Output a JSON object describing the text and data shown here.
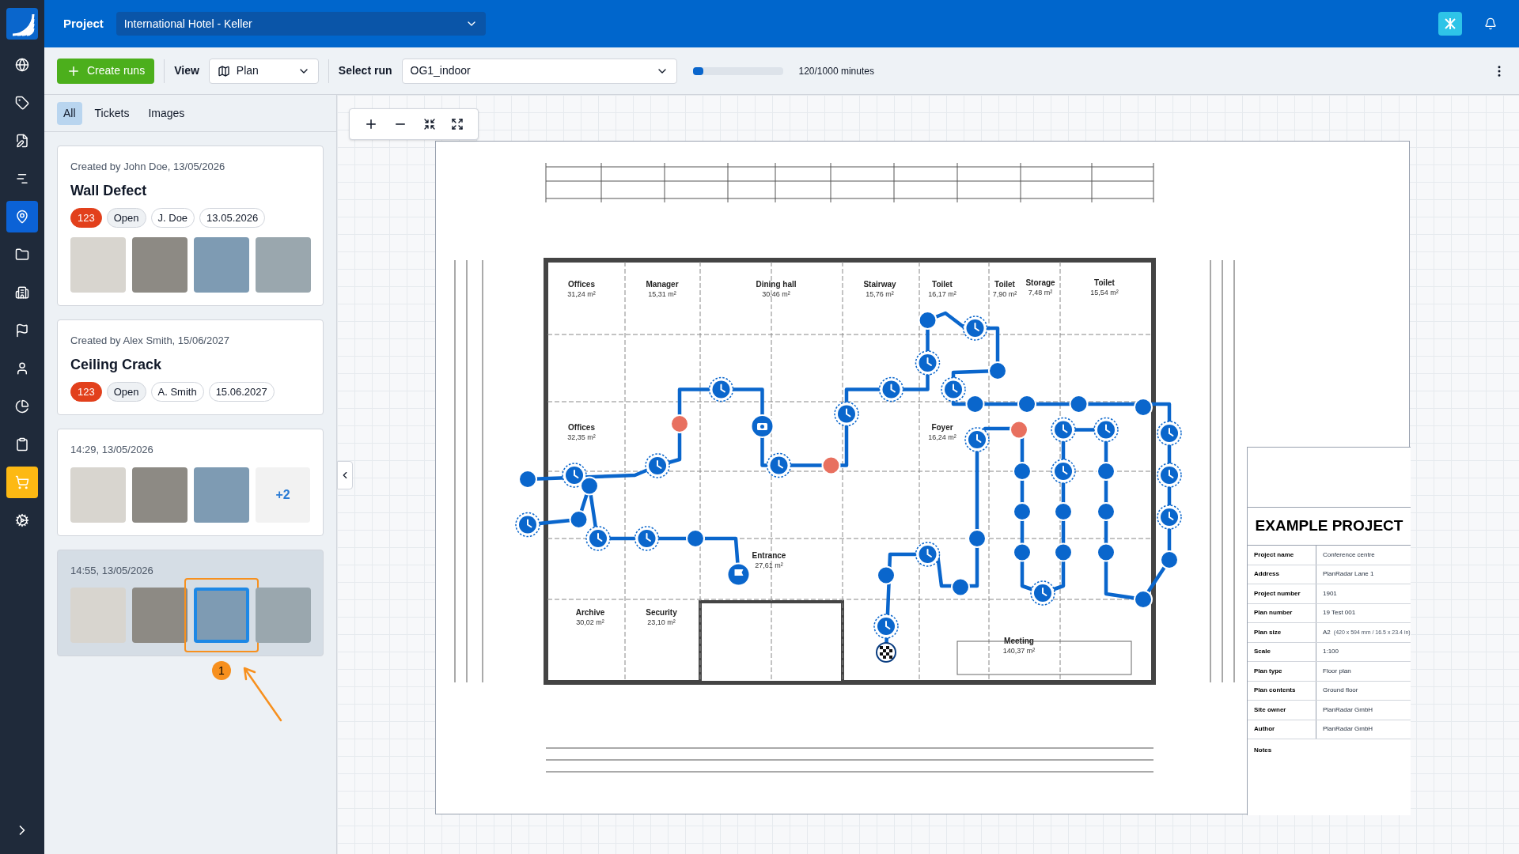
{
  "topbar": {
    "label": "Project",
    "project": "International Hotel - Keller"
  },
  "sidebar": {
    "items": [
      {
        "selected": false,
        "highlighted": false
      },
      {
        "selected": false,
        "highlighted": false
      },
      {
        "selected": false,
        "highlighted": false
      },
      {
        "selected": false,
        "highlighted": false
      },
      {
        "selected": true,
        "highlighted": false
      },
      {
        "selected": false,
        "highlighted": false
      },
      {
        "selected": false,
        "highlighted": false
      },
      {
        "selected": false,
        "highlighted": false
      },
      {
        "selected": false,
        "highlighted": false
      },
      {
        "selected": false,
        "highlighted": false
      },
      {
        "selected": false,
        "highlighted": false
      },
      {
        "selected": false,
        "highlighted": true
      },
      {
        "selected": false,
        "highlighted": false
      }
    ]
  },
  "toolbar": {
    "create_button": "Create runs",
    "view_label": "View",
    "view_value": "Plan",
    "run_label": "Select run",
    "run_value": "OG1_indoor",
    "progress": {
      "level": 0.12,
      "reading": "120/1000 minutes"
    }
  },
  "tabs": [
    {
      "label": "All",
      "selected": true
    },
    {
      "label": "Tickets",
      "selected": false
    },
    {
      "label": "Images",
      "selected": false
    }
  ],
  "cards": [
    {
      "kind": "ticket",
      "selected": false,
      "meta": "Created by John Doe, 13/05/2026",
      "title": "Wall Defect",
      "badges": [
        {
          "kind": "count",
          "text": "123"
        },
        {
          "kind": "status",
          "text": "Open"
        },
        {
          "kind": "person",
          "text": "J. Doe"
        },
        {
          "kind": "date",
          "text": "13.05.2026"
        }
      ],
      "photos": [
        {
          "selected": false
        },
        {
          "selected": false
        },
        {
          "selected": false
        },
        {
          "selected": false
        }
      ]
    },
    {
      "kind": "ticket",
      "selected": false,
      "meta": "Created by Alex Smith, 15/06/2027",
      "title": "Ceiling Crack",
      "badges": [
        {
          "kind": "count",
          "text": "123"
        },
        {
          "kind": "status",
          "text": "Open"
        },
        {
          "kind": "person",
          "text": "A. Smith"
        },
        {
          "kind": "date",
          "text": "15.06.2027"
        }
      ]
    },
    {
      "kind": "images",
      "selected": false,
      "meta": "14:29, 13/05/2026",
      "photos": [
        {
          "selected": false
        },
        {
          "selected": false
        },
        {
          "selected": false
        }
      ],
      "more": "+2"
    },
    {
      "kind": "images",
      "selected": true,
      "meta": "14:55, 13/05/2026",
      "photos": [
        {
          "selected": false
        },
        {
          "selected": false
        },
        {
          "selected": true,
          "callout": "1"
        },
        {
          "selected": false
        }
      ]
    }
  ],
  "plan": {
    "rooms": [
      {
        "name": "Offices",
        "area": "31,24 m²"
      },
      {
        "name": "Manager",
        "area": "15,31 m²"
      },
      {
        "name": "Dining hall",
        "area": "30,46 m²"
      },
      {
        "name": "Stairway",
        "area": "15,76 m²"
      },
      {
        "name": "Toilet",
        "area": "16,17 m²"
      },
      {
        "name": "Toilet",
        "area": "7,90 m²"
      },
      {
        "name": "Storage",
        "area": "7,48 m²"
      },
      {
        "name": "Toilet",
        "area": "15,54 m²"
      },
      {
        "name": "Offices",
        "area": "32,35 m²"
      },
      {
        "name": "Foyer",
        "area": "16,24 m²"
      },
      {
        "name": "Entrance",
        "area": "27,61 m²"
      },
      {
        "name": "Archive",
        "area": "30,02 m²"
      },
      {
        "name": "Security",
        "area": "23,10 m²"
      },
      {
        "name": "Meeting",
        "area": "140,37 m²"
      }
    ],
    "title_block": {
      "title": "EXAMPLE PROJECT",
      "rows": [
        {
          "label": "Project name",
          "value": "Conference centre"
        },
        {
          "label": "Address",
          "value": "PlanRadar Lane 1"
        },
        {
          "label": "Project number",
          "value": "1901"
        },
        {
          "label": "Plan number",
          "value": "19 Test 001"
        },
        {
          "label": "Plan size",
          "value": "A2",
          "note": "(420 x 594 mm / 16.5 x 23.4 in)"
        },
        {
          "label": "Scale",
          "value": "1:100"
        },
        {
          "label": "Plan type",
          "value": "Floor plan"
        },
        {
          "label": "Plan contents",
          "value": "Ground floor"
        },
        {
          "label": "Site owner",
          "value": "PlanRadar GmbH"
        },
        {
          "label": "Author",
          "value": "PlanRadar GmbH"
        }
      ],
      "notes_label": "Notes"
    }
  }
}
